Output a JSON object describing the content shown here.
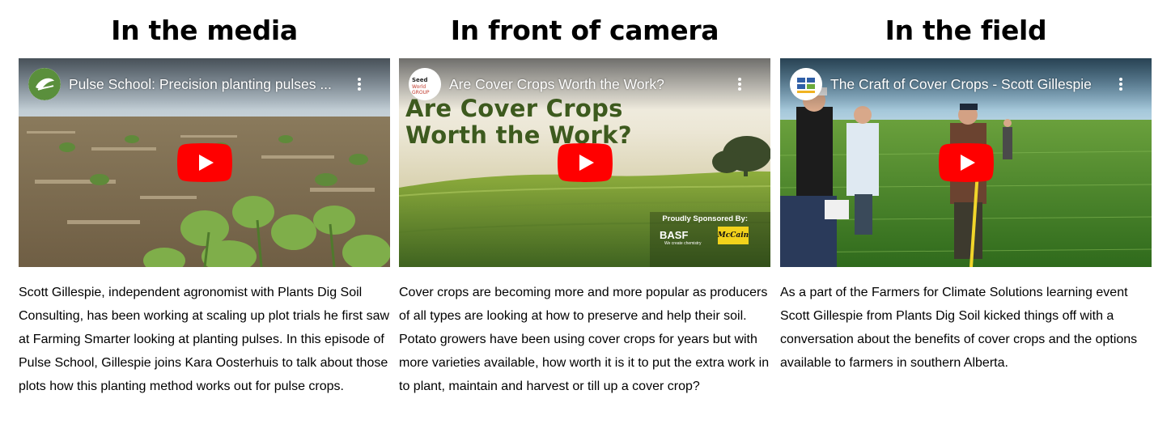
{
  "columns": [
    {
      "heading": "In the media",
      "video": {
        "title": "Pulse School: Precision planting pulses ...",
        "channel_icon": "leaf-logo-icon",
        "menu_icon": "more-vert-icon",
        "play_icon": "youtube-play-icon"
      },
      "description": "Scott Gillespie, independent agronomist with Plants Dig Soil Consulting, has been working at scaling up plot trials he first saw at Farming Smarter looking at planting pulses. In this episode of Pulse School, Gillespie joins Kara Oosterhuis to talk about those plots how this planting method works out for pulse crops."
    },
    {
      "heading": "In front of camera",
      "video": {
        "title": "Are Cover Crops Worth the Work?",
        "channel_icon": "seed-world-group-logo-icon",
        "menu_icon": "more-vert-icon",
        "play_icon": "youtube-play-icon",
        "thumbnail_text_line1": "Are Cover Crops",
        "thumbnail_text_line2": "Worth the Work?",
        "sponsor_label": "Proudly Sponsored By:",
        "sponsor_1": "BASF",
        "sponsor_1_tagline": "We create chemistry",
        "sponsor_2": "McCain"
      },
      "description": "Cover crops are becoming more and more popular as producers of all types are looking at how to preserve and help their soil. Potato growers have been using cover crops for years but with more varieties available, how worth it is it to put the extra work in to plant, maintain and harvest or till up a cover crop?"
    },
    {
      "heading": "In the field",
      "video": {
        "title": "The Craft of Cover Crops - Scott Gillespie",
        "channel_icon": "solar-panel-logo-icon",
        "menu_icon": "more-vert-icon",
        "play_icon": "youtube-play-icon"
      },
      "description": "As a part of the Farmers for Climate Solutions learning event Scott Gillespie from Plants Dig Soil kicked things off with a conversation about the benefits of cover crops and the options available to farmers in southern Alberta."
    }
  ],
  "colors": {
    "youtube_red": "#ff0000",
    "thumbnail_green_text": "#3d5a1e",
    "heading": "#000000",
    "body_text": "#000000"
  }
}
